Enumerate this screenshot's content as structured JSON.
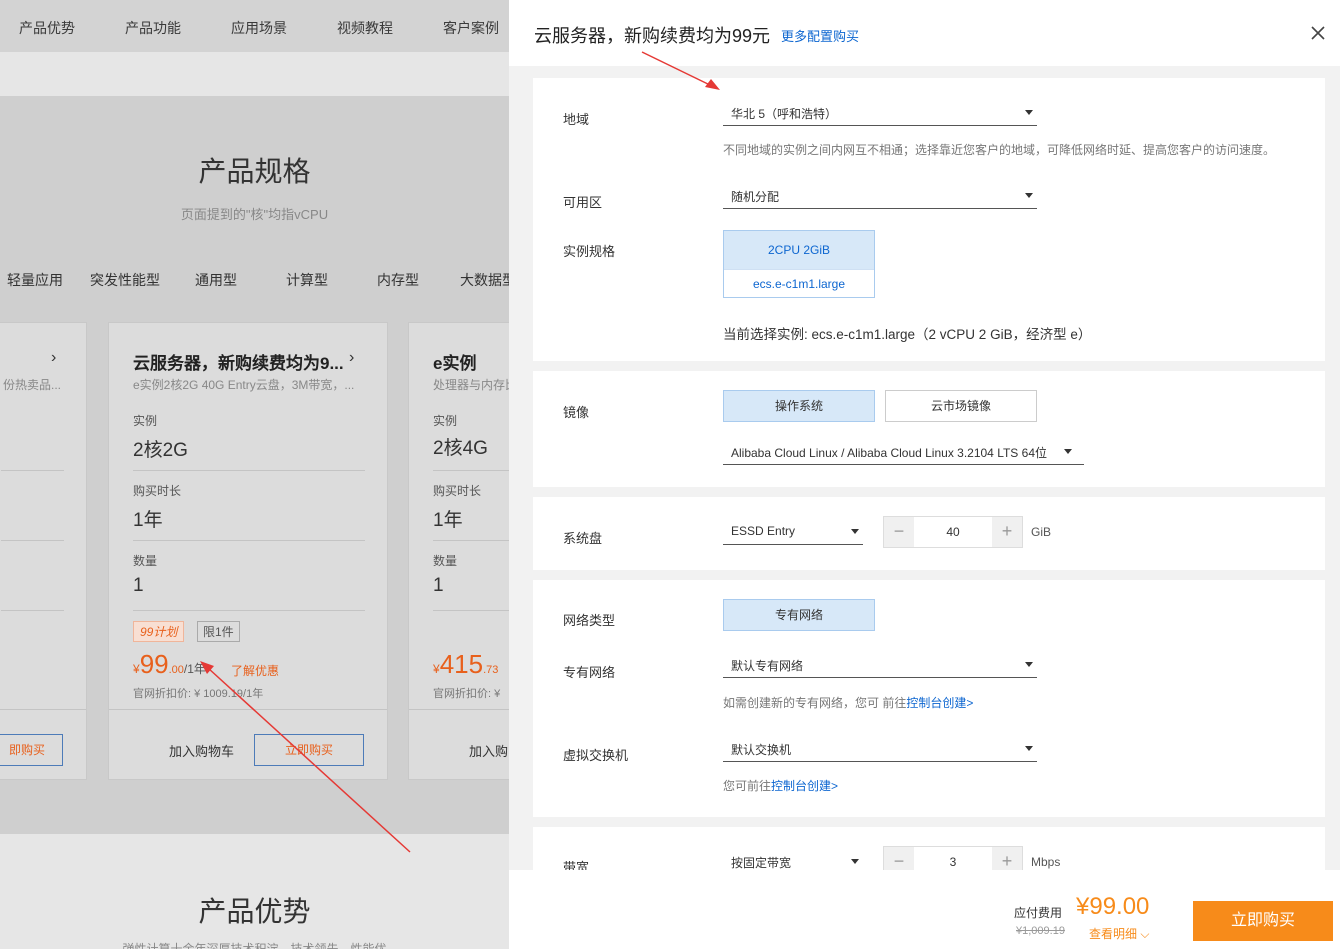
{
  "topnav": [
    "产品优势",
    "产品功能",
    "应用场景",
    "视频教程",
    "客户案例"
  ],
  "spec": {
    "title": "产品规格",
    "subtitle": "页面提到的\"核\"均指vCPU"
  },
  "cat_tabs": [
    "轻量应用",
    "突发性能型",
    "通用型",
    "计算型",
    "内存型",
    "大数据型"
  ],
  "cards": [
    {
      "title": "",
      "desc": "份热卖品...",
      "buy": "即购买"
    },
    {
      "title": "云服务器，新购续费均为9...",
      "desc": "e实例2核2G 40G Entry云盘，3M带宽，...",
      "instance_label": "实例",
      "instance": "2核2G",
      "duration_label": "购买时长",
      "duration": "1年",
      "qty_label": "数量",
      "qty": "1",
      "badge1": "99计划",
      "badge2": "限1件",
      "price_sym": "¥",
      "price_int": "99",
      "price_dec": ".00",
      "price_unit": "/1年",
      "promo": "了解优惠",
      "orig": "官网折扣价: ¥ 1009.19/1年",
      "cart": "加入购物车",
      "buy": "立即购买"
    },
    {
      "title": "e实例",
      "desc": "处理器与内存比",
      "instance_label": "实例",
      "instance": "2核4G",
      "duration_label": "购买时长",
      "duration": "1年",
      "qty_label": "数量",
      "qty": "1",
      "price_sym": "¥",
      "price_int": "415",
      "price_dec": ".73",
      "orig": "官网折扣价: ¥",
      "cart": "加入购"
    }
  ],
  "advantage_title": "产品优势",
  "advantage_sub": "弹性计算十余年深厚技术积淀，技术领先、性能优",
  "panel": {
    "title": "云服务器，新购续费均为99元",
    "link": "更多配置购买",
    "region": {
      "label": "地域",
      "value": "华北 5（呼和浩特）",
      "hint": "不同地域的实例之间内网互不相通；选择靠近您客户的地域，可降低网络时延、提高您客户的访问速度。"
    },
    "zone": {
      "label": "可用区",
      "value": "随机分配"
    },
    "spec": {
      "label": "实例规格",
      "cpu": "2CPU 2GiB",
      "type": "ecs.e-c1m1.large",
      "current": "当前选择实例: ecs.e-c1m1.large（2 vCPU 2 GiB，经济型 e）"
    },
    "image": {
      "label": "镜像",
      "tab1": "操作系统",
      "tab2": "云市场镜像",
      "os": "Alibaba Cloud Linux / Alibaba Cloud Linux 3.2104 LTS 64位"
    },
    "disk": {
      "label": "系统盘",
      "type": "ESSD Entry",
      "size": "40",
      "unit": "GiB"
    },
    "network": {
      "label": "网络类型",
      "value": "专有网络"
    },
    "vpc": {
      "label": "专有网络",
      "value": "默认专有网络",
      "hint": "如需创建新的专有网络，您可 前往",
      "hint_link": "控制台创建>"
    },
    "vswitch": {
      "label": "虚拟交换机",
      "value": "默认交换机",
      "hint": "您可前往",
      "hint_link": "控制台创建>"
    },
    "bandwidth": {
      "label": "带宽",
      "type": "按固定带宽",
      "value": "3",
      "unit": "Mbps"
    },
    "footer": {
      "fee_label": "应付费用",
      "price": "¥99.00",
      "orig": "¥1,009.19",
      "detail": "查看明细",
      "buy": "立即购买"
    }
  },
  "colors": {
    "accent": "#f78b1a",
    "link": "#0d66d0",
    "price": "#e8601c",
    "arrow": "#e53935"
  }
}
